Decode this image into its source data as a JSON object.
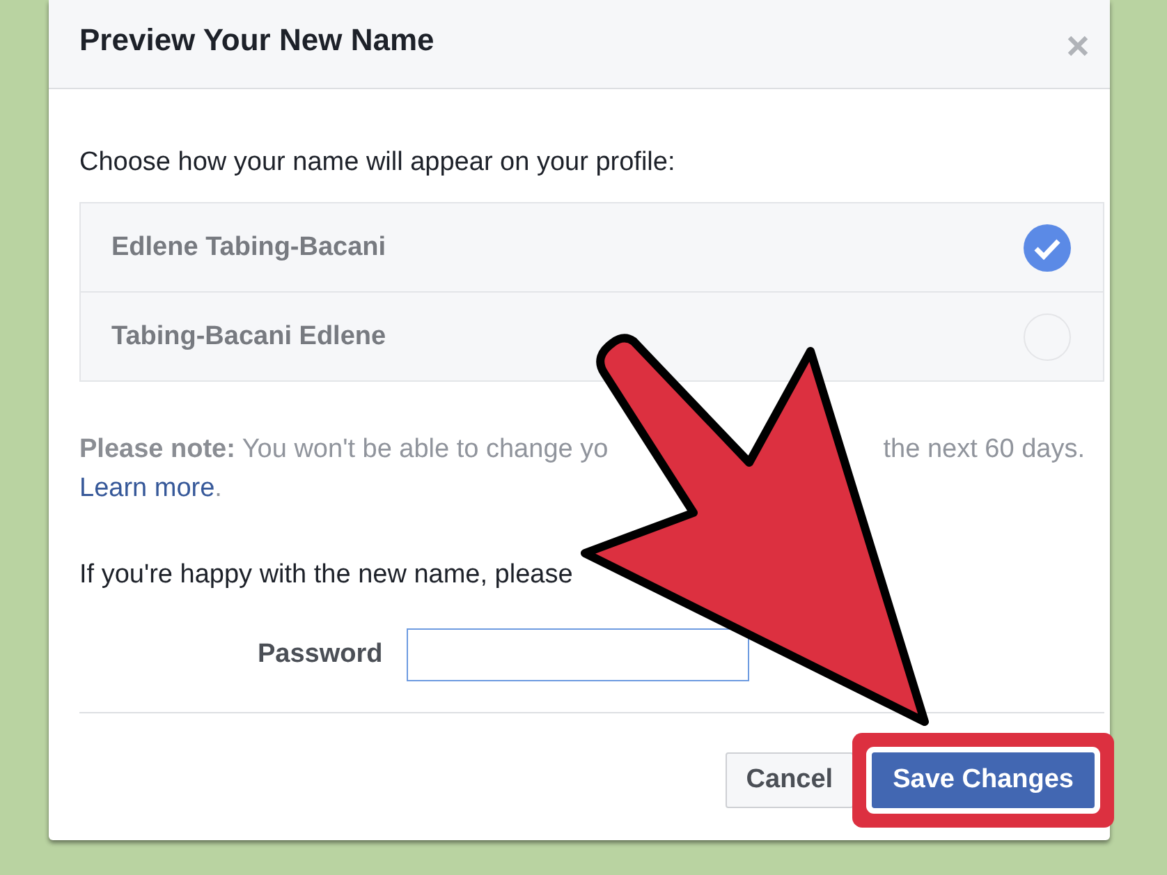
{
  "dialog": {
    "title": "Preview Your New Name",
    "prompt": "Choose how your name will appear on your profile:",
    "name_options": [
      {
        "label": "Edlene Tabing-Bacani",
        "selected": true
      },
      {
        "label": "Tabing-Bacani Edlene",
        "selected": false
      }
    ],
    "note": {
      "parts": [
        "**Please note:** You won't be able to change yo",
        "the next 60 days."
      ],
      "link": "Learn more",
      "link_suffix": "."
    },
    "confirm_text": "If you're happy with the new name, please",
    "password": {
      "label": "Password"
    },
    "buttons": [
      {
        "label": "Cancel",
        "kind": "secondary",
        "highlighted": false
      },
      {
        "label": "Save Changes",
        "kind": "primary",
        "highlighted": true
      }
    ]
  },
  "arrow_overlay": true
}
